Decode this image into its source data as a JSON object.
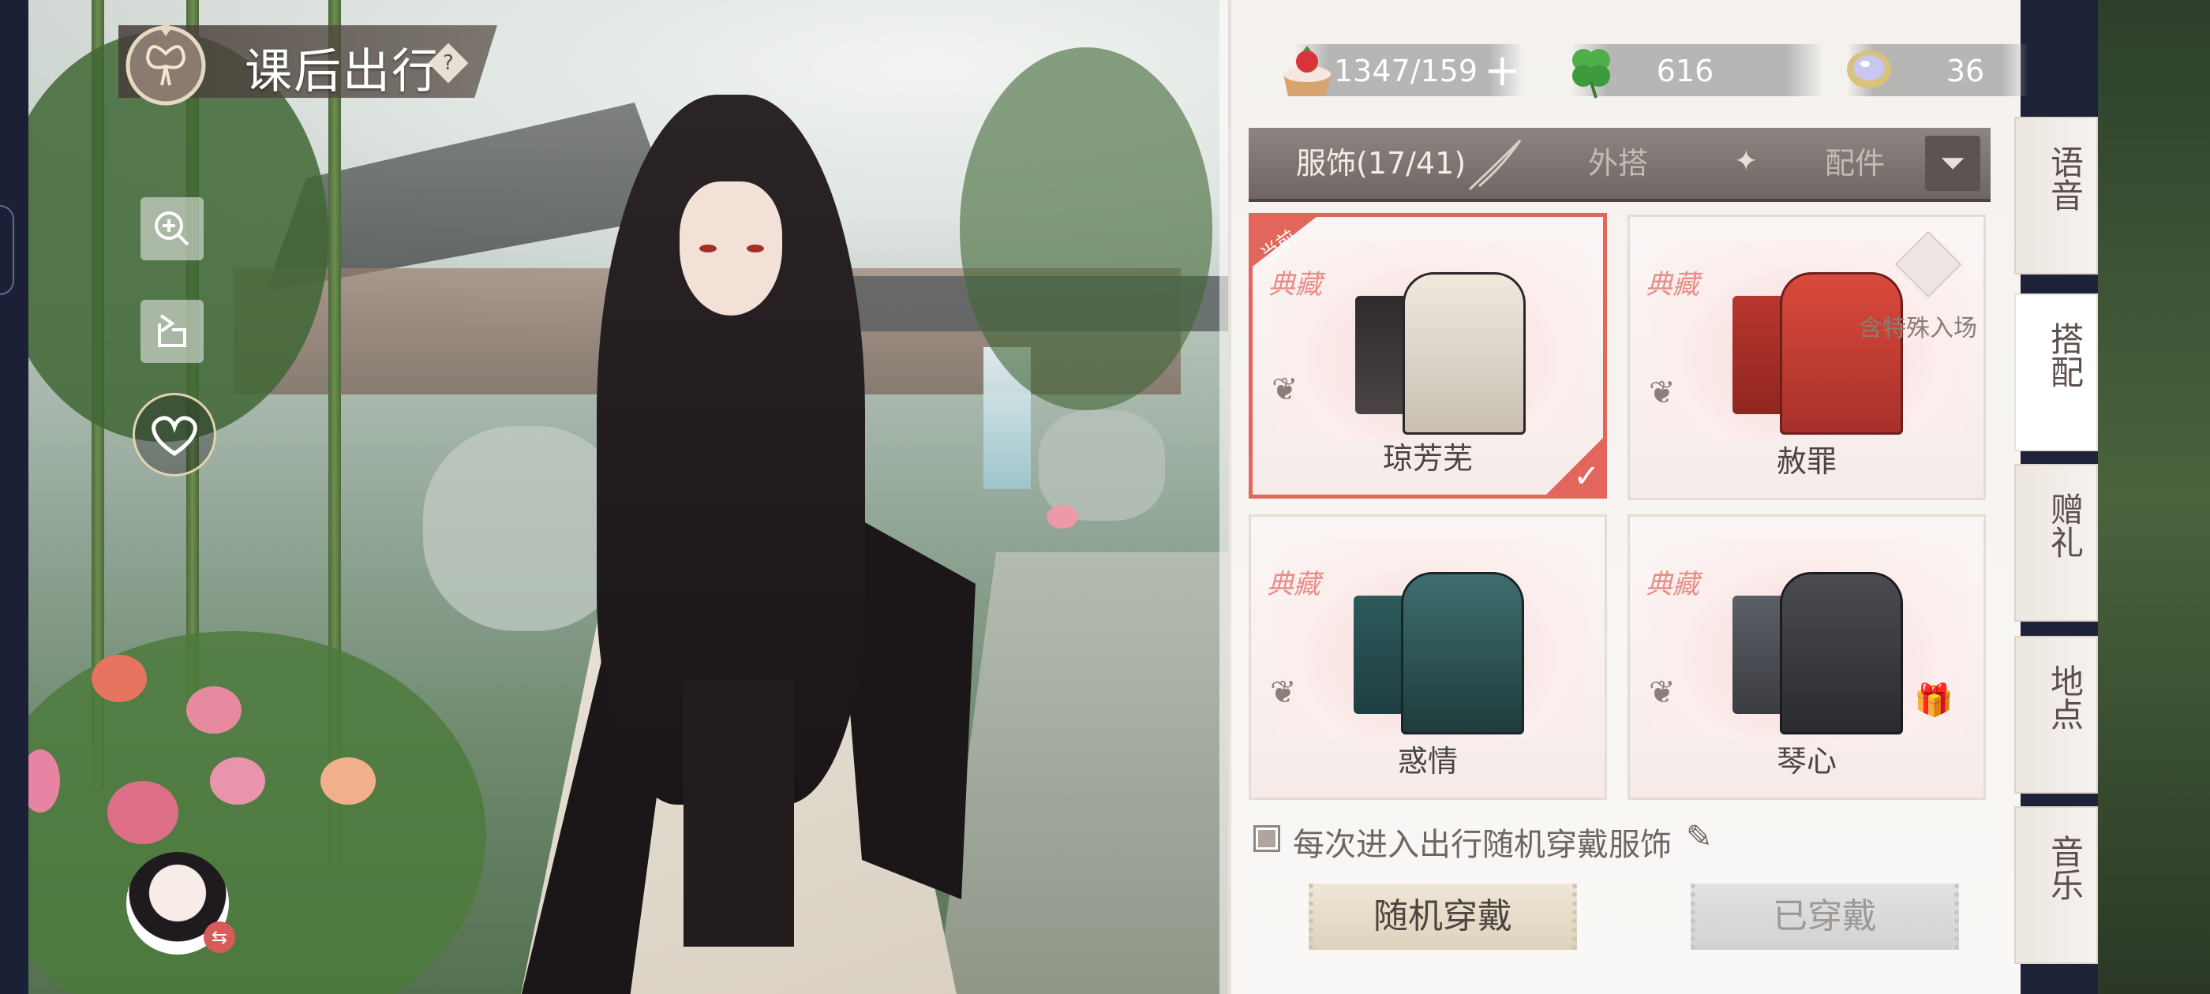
{
  "header": {
    "title": "课后出行",
    "help_label": "?"
  },
  "resources": {
    "stamina": "1347/159",
    "clover": "616",
    "gem": "36",
    "plus_label": "+"
  },
  "tabs": [
    {
      "label": "服饰(17/41)"
    },
    {
      "label": "外搭"
    },
    {
      "label": "配件"
    }
  ],
  "outfits": [
    {
      "tag": "典藏",
      "name": "琼芳芜",
      "current": true,
      "current_label": "当前"
    },
    {
      "tag": "典藏",
      "name": "赦罪",
      "special_label": "含特殊入场"
    },
    {
      "tag": "典藏",
      "name": "惑情"
    },
    {
      "tag": "典藏",
      "name": "琴心"
    }
  ],
  "options": {
    "random_each_time": "每次进入出行随机穿戴服饰",
    "random_each_time_checked": true
  },
  "buttons": {
    "random_wear": "随机穿戴",
    "worn": "已穿戴"
  },
  "side_tabs": [
    {
      "label": "语音"
    },
    {
      "label": "搭配"
    },
    {
      "label": "赠礼"
    },
    {
      "label": "地点"
    },
    {
      "label": "音乐"
    }
  ],
  "colors": {
    "accent": "#e2665c",
    "tag": "#e98d88"
  }
}
